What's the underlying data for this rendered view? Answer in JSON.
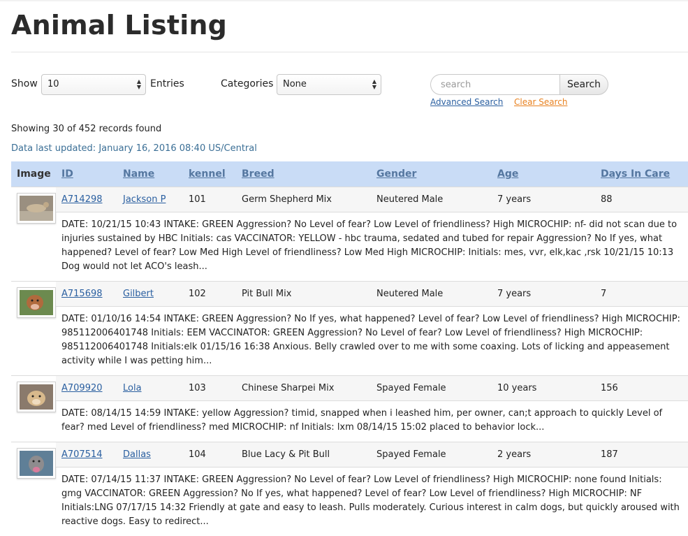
{
  "page": {
    "title": "Animal Listing"
  },
  "controls": {
    "show_label": "Show",
    "show_value": "10",
    "entries_label": "Entries",
    "categories_label": "Categories",
    "categories_value": "None",
    "search_placeholder": "search",
    "search_button": "Search",
    "advanced_search": "Advanced Search",
    "clear_search": "Clear Search"
  },
  "status": {
    "records": "Showing 30 of 452 records found",
    "updated": "Data last updated: January 16, 2016 08:40 US/Central"
  },
  "table": {
    "headers": {
      "image": "Image",
      "id": "ID",
      "name": "Name",
      "kennel": "kennel",
      "breed": "Breed",
      "gender": "Gender",
      "age": "Age",
      "days": "Days In Care"
    },
    "rows": [
      {
        "id": "A714298",
        "name": "Jackson P",
        "kennel": "101",
        "breed": "Germ Shepherd Mix",
        "gender": "Neutered Male",
        "age": "7 years",
        "days": "88",
        "description": "DATE: 10/21/15 10:43 INTAKE: GREEN Aggression? No Level of fear? Low Level of friendliness? High MICROCHIP: nf- did not scan due to injuries sustained by HBC Initials: cas VACCINATOR: YELLOW - hbc trauma, sedated and tubed for repair Aggression? No If yes, what happened? Level of fear? Low Med High Level of friendliness? Low Med High MICROCHIP: Initials: mes, vvr, elk,kac ,rsk 10/21/15 10:13 Dog would not let ACO's leash..."
      },
      {
        "id": "A715698",
        "name": "Gilbert",
        "kennel": "102",
        "breed": "Pit Bull Mix",
        "gender": "Neutered Male",
        "age": "7 years",
        "days": "7",
        "description": "DATE: 01/10/16 14:54 INTAKE: GREEN Aggression? No If yes, what happened? Level of fear? Low Level of friendliness? High MICROCHIP: 985112006401748 Initials: EEM VACCINATOR: GREEN Aggression? No Level of fear? Low Level of friendliness? High MICROCHIP: 985112006401748 Initials:elk 01/15/16 16:38 Anxious. Belly crawled over to me with some coaxing. Lots of licking and appeasement activity while I was petting him..."
      },
      {
        "id": "A709920",
        "name": "Lola",
        "kennel": "103",
        "breed": "Chinese Sharpei Mix",
        "gender": "Spayed Female",
        "age": "10 years",
        "days": "156",
        "description": "DATE: 08/14/15 14:59 INTAKE: yellow Aggression? timid, snapped when i leashed him, per owner, can;t approach to quickly Level of fear? med Level of friendliness? med MICROCHIP: nf Initials: lxm 08/14/15 15:02 placed to behavior lock..."
      },
      {
        "id": "A707514",
        "name": "Dallas",
        "kennel": "104",
        "breed": "Blue Lacy & Pit Bull",
        "gender": "Spayed Female",
        "age": "2 years",
        "days": "187",
        "description": "DATE: 07/14/15 11:37 INTAKE: GREEN Aggression? No Level of fear? Low Level of friendliness? High MICROCHIP: none found Initials: gmg VACCINATOR: GREEN Aggression? No If yes, what happened? Level of fear? Low Level of friendliness? High MICROCHIP: NF Initials:LNG 07/17/15 14:32 Friendly at gate and easy to leash. Pulls moderately. Curious interest in calm dogs, but quickly aroused with reactive dogs. Easy to redirect..."
      }
    ]
  },
  "colors": {
    "header_bg": "#c9dcf6",
    "link": "#2a5fa0",
    "clear_link": "#e8811f",
    "updated_text": "#3b6f96"
  }
}
